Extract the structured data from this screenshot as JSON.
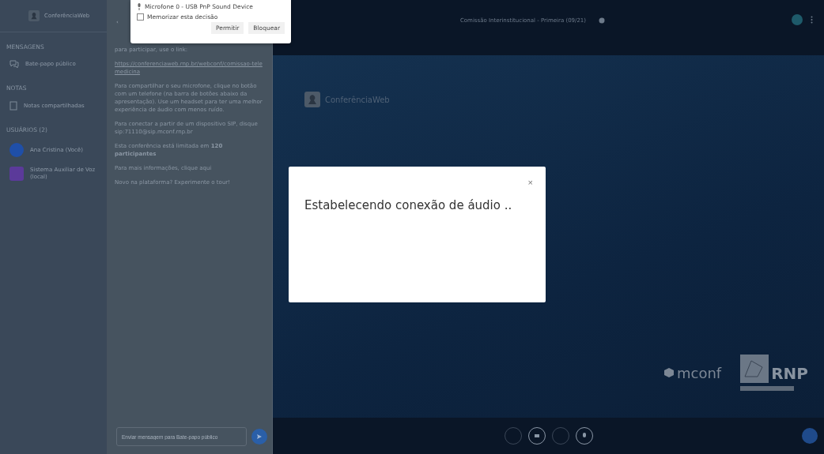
{
  "sidebar": {
    "logo": "ConferênciaWeb",
    "sections": [
      {
        "title": "MENSAGENS",
        "items": [
          {
            "label": "Bate-papo público",
            "kind": "chat"
          }
        ]
      },
      {
        "title": "NOTAS",
        "items": [
          {
            "label": "Notas compartilhadas",
            "kind": "notes"
          }
        ]
      },
      {
        "title": "USUÁRIOS (2)",
        "items": [
          {
            "label": "Ana Cristina (Você)",
            "kind": "user",
            "color": "#1f4fa8"
          },
          {
            "label": "Sistema Auxiliar de Voz (local)",
            "kind": "user-square",
            "color": "#5b3a9a"
          }
        ]
      }
    ]
  },
  "chat": {
    "back": "‹",
    "messages": [
      "para participar, use o link:",
      "https://conferenciaweb.rnp.br/webconf/comissao-telemedicina",
      "Para compartilhar o seu microfone, clique no botão com um telefone (na barra de botões abaixo da apresentação). Use um headset para ter uma melhor experiência de áudio com menos ruído.",
      "Para conectar a partir de um dispositivo SIP, disque sip:71110@sip.mconf.rnp.br",
      "Esta conferência está limitada em **120 participantes**",
      "Para mais informações, clique aqui",
      "Novo na plataforma? Experimente o tour!"
    ],
    "input": {
      "placeholder": "Enviar mensagem para Bate-papo público"
    }
  },
  "permission_popup": {
    "device": "Microfone 0 - USB PnP Sound Device",
    "remember": {
      "label": "Memorizar esta decisão",
      "checked": false
    },
    "buttons": [
      "Permitir",
      "Bloquear"
    ]
  },
  "topbar": {
    "title": "Comissão Interinstitucional - Primeira (09/21)"
  },
  "presentation": {
    "logo": "ConferênciaWeb",
    "footer_logos": [
      "mconf",
      "RNP"
    ]
  },
  "modal": {
    "close": "×",
    "message": "Estabelecendo conexão de áudio .."
  }
}
